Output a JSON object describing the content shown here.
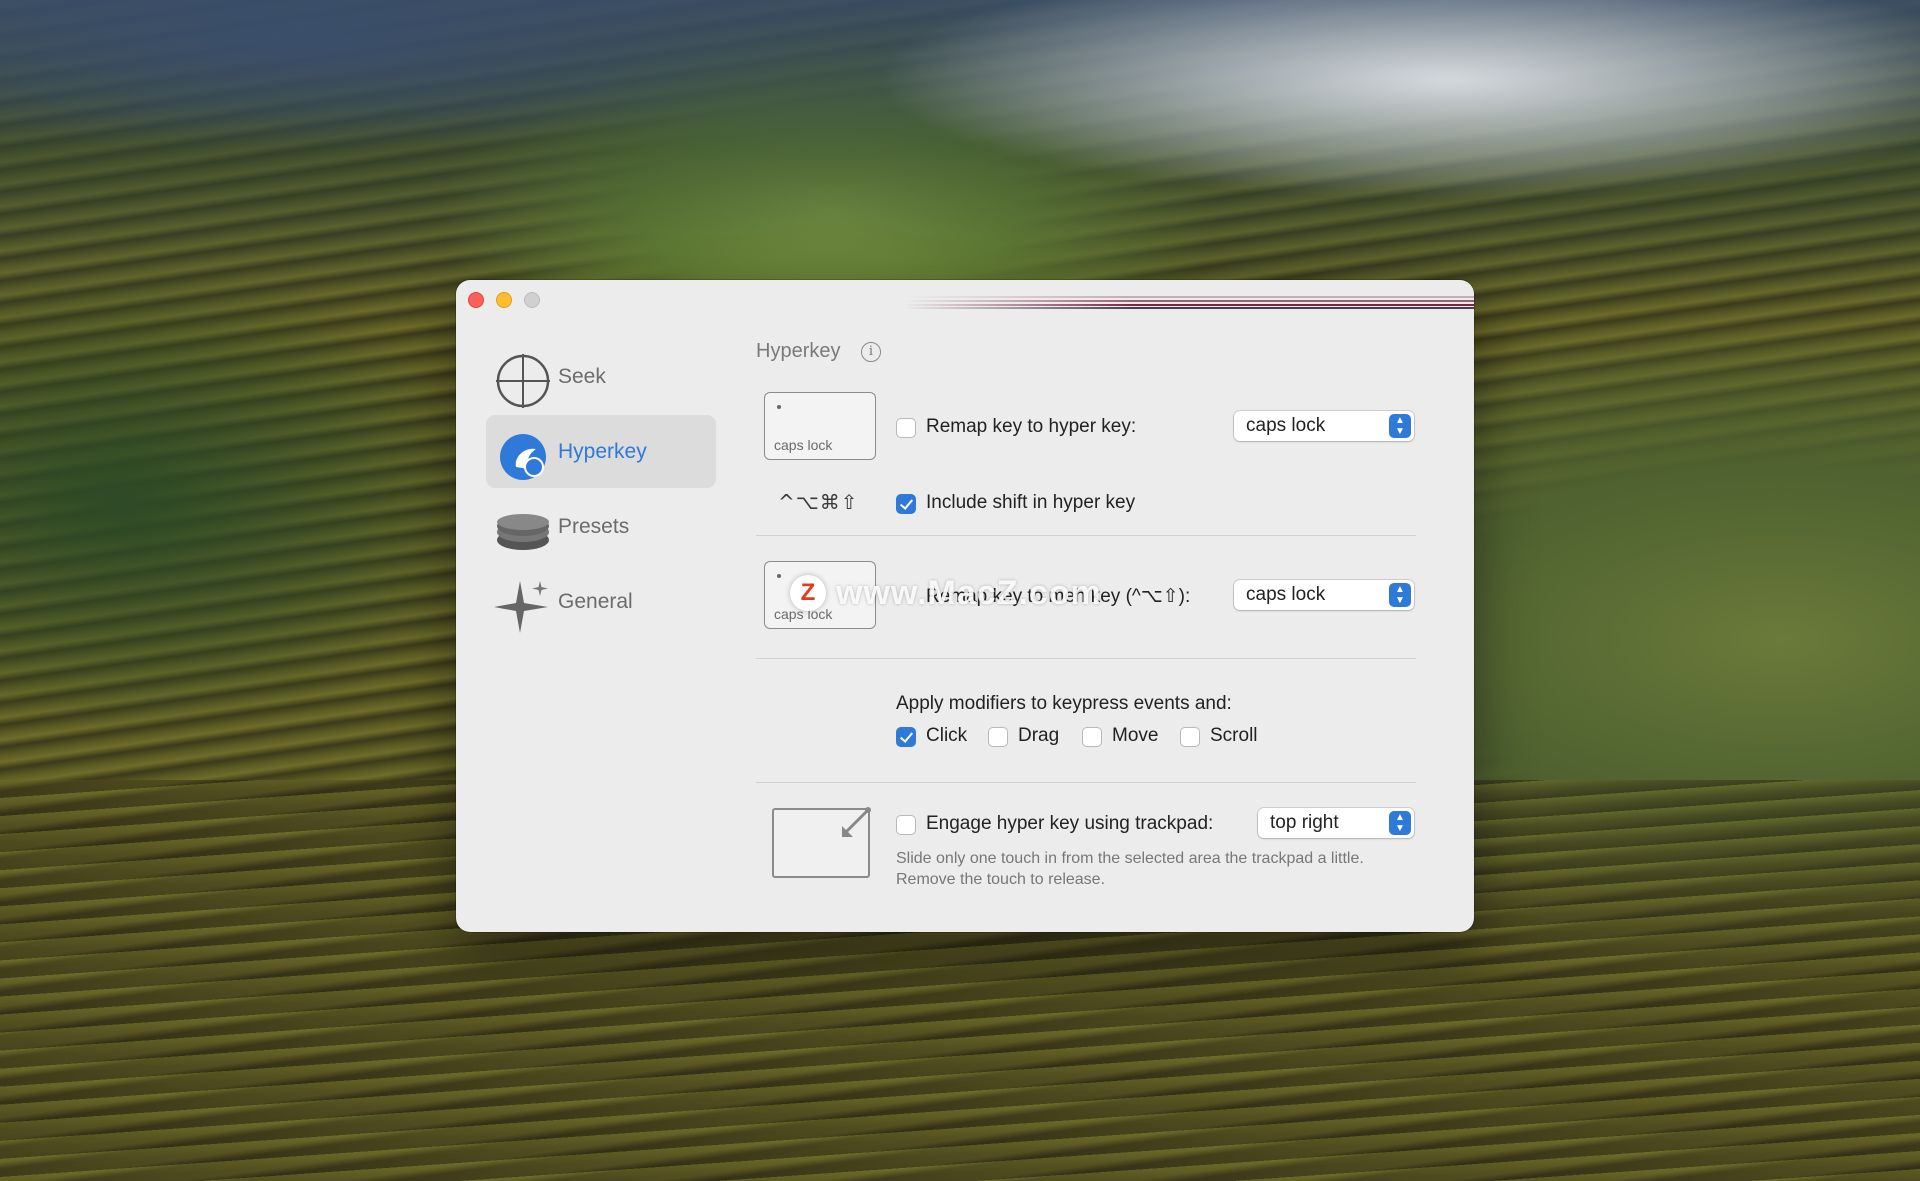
{
  "sidebar": {
    "items": [
      {
        "label": "Seek",
        "icon": "crosshair-icon",
        "active": false
      },
      {
        "label": "Hyperkey",
        "icon": "hyperkey-icon",
        "active": true
      },
      {
        "label": "Presets",
        "icon": "stack-icon",
        "active": false
      },
      {
        "label": "General",
        "icon": "sparkle-icon",
        "active": false
      }
    ]
  },
  "hyperkey": {
    "title": "Hyperkey",
    "info_glyph": "i",
    "remap": {
      "keycap_label": "caps lock",
      "checkbox_label": "Remap key to hyper key:",
      "checked": false,
      "select_value": "caps lock"
    },
    "modifiers_display": "^⌥⌘⇧",
    "include_shift": {
      "label": "Include shift in hyper key",
      "checked": true
    },
    "remap_meh": {
      "keycap_label": "caps lock",
      "label": "Remap key to meh key (^⌥⇧):",
      "select_value": "caps lock"
    },
    "apply": {
      "label": "Apply modifiers to keypress events and:",
      "options": [
        {
          "label": "Click",
          "checked": true
        },
        {
          "label": "Drag",
          "checked": false
        },
        {
          "label": "Move",
          "checked": false
        },
        {
          "label": "Scroll",
          "checked": false
        }
      ]
    },
    "trackpad": {
      "label": "Engage hyper key using trackpad:",
      "checked": false,
      "select_value": "top right",
      "help_line1": "Slide only one touch in from the selected area the trackpad a little.",
      "help_line2": "Remove the touch to release."
    }
  },
  "watermark": {
    "logo_letter": "Z",
    "text": "www.MacZ.com"
  },
  "colors": {
    "accent": "#2f79d8",
    "close": "#fe5f57",
    "minimize": "#febc2e",
    "zoom": "#d0d0d0"
  }
}
